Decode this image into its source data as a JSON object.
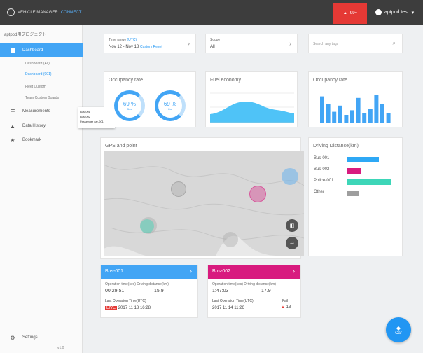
{
  "header": {
    "logo_text": "VEHICLE MANAGER",
    "logo_sub": "CONNECT",
    "alert_count": "99+",
    "user_name": "aptpod test"
  },
  "sidebar": {
    "project": "aptpod用プロジェクト",
    "items": [
      {
        "label": "Dashboard",
        "icon": "dashboard-icon"
      },
      {
        "label": "Measurements",
        "icon": "list-icon"
      },
      {
        "label": "Data History",
        "icon": "warning-icon"
      },
      {
        "label": "Bookmark",
        "icon": "star-icon"
      }
    ],
    "sub_items": [
      "Dashboard (All)",
      "Dashboard (001)",
      "Fleet Custom",
      "Team Custom Boards"
    ],
    "popup": [
      "Bus-001",
      "Bus-002",
      "Passenger car-001"
    ],
    "settings": "Settings",
    "version": "v1.0"
  },
  "filters": {
    "time_range_label": "Time range",
    "time_range_tag": "(UTC)",
    "time_range_value": "Nov 12 - Nov 18",
    "time_range_link": "Custom Reset",
    "scope_label": "Scope",
    "scope_value": "All",
    "search_placeholder": "Search any tags"
  },
  "widgets": {
    "occupancy1_title": "Occupancy rate",
    "donut1_value": "69 %",
    "donut1_sub": "Bus",
    "donut2_value": "69 %",
    "donut2_sub": "Car",
    "fuel_title": "Fuel economy",
    "occupancy2_title": "Occupancy rate",
    "gps_title": "GPS and point",
    "distance_title": "Driving Distance(km)",
    "distance_rows": [
      {
        "name": "Bus-001",
        "value": 0.72,
        "color": "#2ea8f5"
      },
      {
        "name": "Bus-002",
        "value": 0.3,
        "color": "#d81b7f"
      },
      {
        "name": "Police-001",
        "value": 1.0,
        "color": "#3dd6b8"
      },
      {
        "name": "Other",
        "value": 0.28,
        "color": "#9e9e9e"
      }
    ],
    "bar_chart_values": [
      0.85,
      0.6,
      0.35,
      0.55,
      0.25,
      0.4,
      0.8,
      0.3,
      0.45,
      0.9,
      0.6,
      0.3
    ]
  },
  "vehicles": [
    {
      "name": "Bus-001",
      "color": "#42a5f5",
      "stat_label": "Operation time(sec)  Driving distance(km)",
      "stat_values": [
        "00:29:51",
        "15.9"
      ],
      "last_label": "Last Operation Time(UTC)",
      "last_value": "2017 11 18 16:28",
      "live": "LIVE",
      "fail_label": ""
    },
    {
      "name": "Bus-002",
      "color": "#d81b7f",
      "stat_label": "Operation time(sec)  Driving distance(km)",
      "stat_values": [
        "1:47:03",
        "17.9"
      ],
      "last_label": "Last Operation Time(UTC)",
      "last_value": "2017 11 14 11:26",
      "live": "",
      "fail_label": "Fail",
      "fail_count": "13"
    }
  ],
  "fab_label": "Car"
}
